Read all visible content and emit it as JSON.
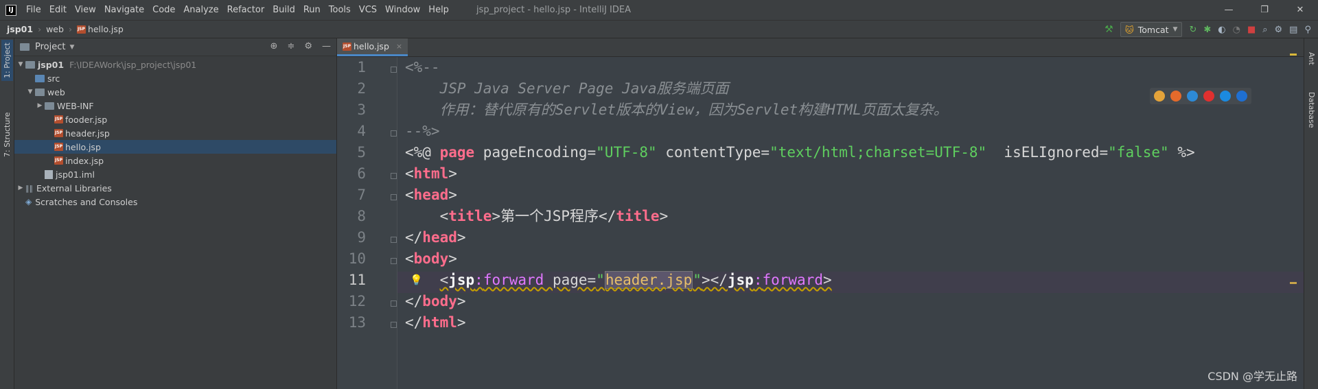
{
  "titlebar": {
    "app_icon_text": "IJ",
    "menu": [
      "File",
      "Edit",
      "View",
      "Navigate",
      "Code",
      "Analyze",
      "Refactor",
      "Build",
      "Run",
      "Tools",
      "VCS",
      "Window",
      "Help"
    ],
    "window_title": "jsp_project - hello.jsp - IntelliJ IDEA",
    "controls": [
      "—",
      "❐",
      "✕"
    ]
  },
  "navbar": {
    "crumbs": [
      "jsp01",
      "web",
      "hello.jsp"
    ],
    "run_config": "Tomcat"
  },
  "left_strip": {
    "tabs": [
      "1: Project",
      "7: Structure"
    ]
  },
  "right_strip": {
    "tabs": [
      "Ant",
      "Database"
    ]
  },
  "project_panel": {
    "title": "Project",
    "tree": [
      {
        "label": "jsp01",
        "path": "F:\\IDEAWork\\jsp_project\\jsp01"
      },
      {
        "label": "src"
      },
      {
        "label": "web"
      },
      {
        "label": "WEB-INF"
      },
      {
        "label": "fooder.jsp"
      },
      {
        "label": "header.jsp"
      },
      {
        "label": "hello.jsp"
      },
      {
        "label": "index.jsp"
      },
      {
        "label": "jsp01.iml"
      },
      {
        "label": "External Libraries"
      },
      {
        "label": "Scratches and Consoles"
      }
    ]
  },
  "editor": {
    "tab": "hello.jsp",
    "line_numbers": [
      "1",
      "2",
      "3",
      "4",
      "5",
      "6",
      "7",
      "8",
      "9",
      "10",
      "11",
      "12",
      "13"
    ],
    "current_line": 11,
    "lines": {
      "l1": "<%--",
      "l2": "    JSP Java Server Page Java服务端页面",
      "l3": "    作用：替代原有的Servlet版本的View，因为Servlet构建HTML页面太复杂。",
      "l4": "--%>",
      "l5_open": "<%@ ",
      "l5_kw": "page",
      "l5_a1": " pageEncoding=",
      "l5_v1": "\"UTF-8\"",
      "l5_a2": " contentType=",
      "l5_v2": "\"text/html;charset=UTF-8\"",
      "l5_a3": "  isELIgnored=",
      "l5_v3": "\"false\"",
      "l5_close": " %>",
      "l6_lt": "<",
      "l6_tag": "html",
      "l6_gt": ">",
      "l7_lt": "<",
      "l7_tag": "head",
      "l7_gt": ">",
      "l8_indent": "    ",
      "l8_lt": "<",
      "l8_tag": "title",
      "l8_gt": ">",
      "l8_text": "第一个JSP程序",
      "l8_lt2": "</",
      "l8_tag2": "title",
      "l8_gt2": ">",
      "l9_lt": "</",
      "l9_tag": "head",
      "l9_gt": ">",
      "l10_lt": "<",
      "l10_tag": "body",
      "l10_gt": ">",
      "l11_indent": "    ",
      "l11_lt": "<",
      "l11_ns": "jsp",
      "l11_colon": ":",
      "l11_name": "forward",
      "l11_attr": " page=",
      "l11_q1": "\"",
      "l11_val": "header.jsp",
      "l11_q2": "\"",
      "l11_mid": "></",
      "l11_ns2": "jsp",
      "l11_colon2": ":",
      "l11_name2": "forward",
      "l11_end": ">",
      "l12_lt": "</",
      "l12_tag": "body",
      "l12_gt": ">",
      "l13_lt": "</",
      "l13_tag": "html",
      "l13_gt": ">"
    }
  },
  "browser_colors": [
    "#e4a33a",
    "#e46a2b",
    "#2d8ad6",
    "#e0302f",
    "#1b8ae0",
    "#1f6fd1"
  ],
  "watermark": "CSDN @学无止路"
}
